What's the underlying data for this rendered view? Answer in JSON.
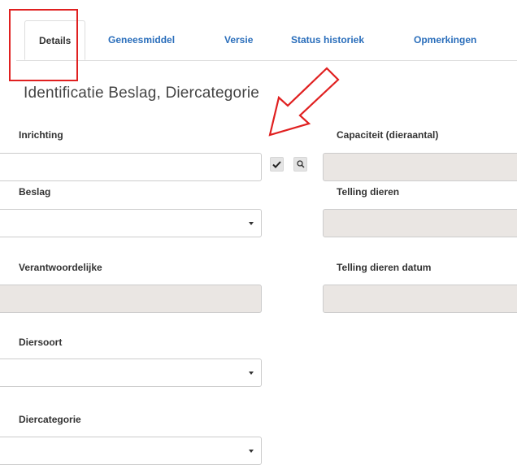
{
  "tabs": [
    {
      "label": "Details",
      "active": true
    },
    {
      "label": "Geneesmiddel",
      "active": false
    },
    {
      "label": "Versie",
      "active": false
    },
    {
      "label": "Status historiek",
      "active": false
    },
    {
      "label": "Opmerkingen",
      "active": false
    }
  ],
  "section": {
    "title": "Identificatie Beslag, Diercategorie"
  },
  "form": {
    "left": {
      "inrichting_label": "Inrichting",
      "inrichting_value": "",
      "beslag_label": "Beslag",
      "beslag_value": "",
      "verantwoordelijke_label": "Verantwoordelijke",
      "verantwoordelijke_value": "",
      "diersoort_label": "Diersoort",
      "diersoort_value": "",
      "diercategorie_label": "Diercategorie",
      "diercategorie_value": ""
    },
    "right": {
      "capaciteit_label": "Capaciteit (dieraantal)",
      "capaciteit_value": "",
      "telling_label": "Telling dieren",
      "telling_value": "",
      "telling_datum_label": "Telling dieren datum",
      "telling_datum_value": ""
    }
  },
  "icons": {
    "confirm": "check-icon",
    "search": "search-icon",
    "dropdown": "caret-down-icon"
  },
  "colors": {
    "tab_link": "#2a6ebb",
    "annotation": "#e02020",
    "readonly_bg": "#eae6e3",
    "border": "#cccccc"
  }
}
